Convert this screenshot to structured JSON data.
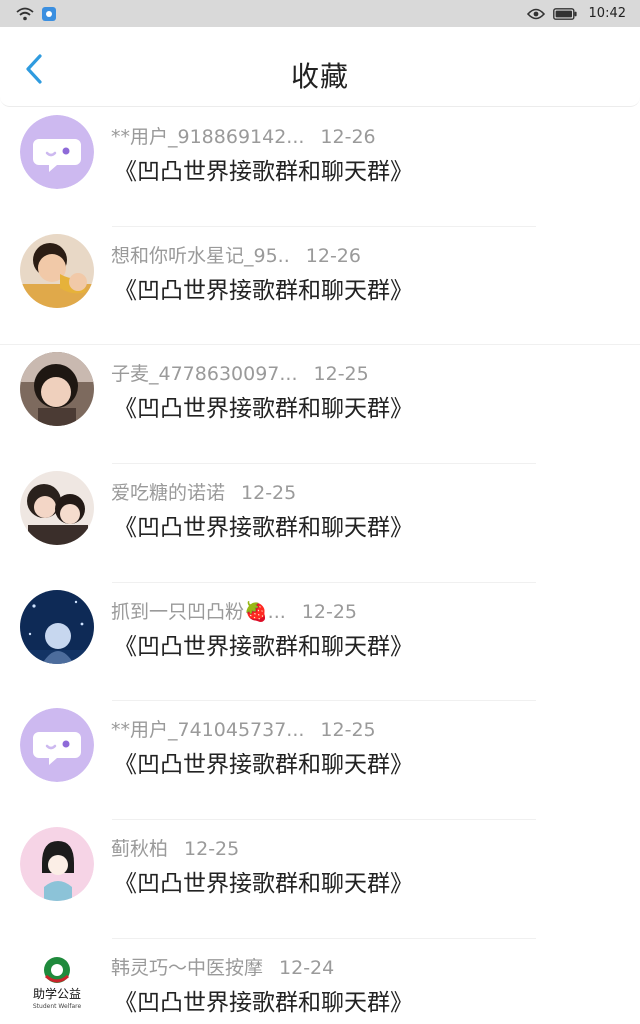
{
  "status": {
    "time": "10:42"
  },
  "header": {
    "title": "收藏"
  },
  "items": [
    {
      "user": "**用户_918869142...",
      "date": "12-26",
      "message": "《凹凸世界接歌群和聊天群》",
      "avatar": "chat-bubble"
    },
    {
      "user": "想和你听水星记_95..",
      "date": "12-26",
      "message": "《凹凸世界接歌群和聊天群》",
      "avatar": "photo-child-eating"
    },
    {
      "user": "子麦_4778630097...",
      "date": "12-25",
      "message": "《凹凸世界接歌群和聊天群》",
      "avatar": "photo-girl"
    },
    {
      "user": "爱吃糖的诺诺",
      "date": "12-25",
      "message": "《凹凸世界接歌群和聊天群》",
      "avatar": "photo-two-girls"
    },
    {
      "user": "抓到一只凹凸粉🍓...",
      "date": "12-25",
      "message": "《凹凸世界接歌群和聊天群》",
      "avatar": "photo-anime-night"
    },
    {
      "user": "**用户_741045737...",
      "date": "12-25",
      "message": "《凹凸世界接歌群和聊天群》",
      "avatar": "chat-bubble"
    },
    {
      "user": "蓟秋柏",
      "date": "12-25",
      "message": "《凹凸世界接歌群和聊天群》",
      "avatar": "illustration-girl"
    },
    {
      "user": "韩灵巧～中医按摩",
      "date": "12-24",
      "message": "《凹凸世界接歌群和聊天群》",
      "avatar": "logo-student-welfare",
      "logo_text": "助学公益",
      "logo_subtext": "Student Welfare"
    }
  ],
  "colors": {
    "accent": "#2f9bdf",
    "bubble_bg": "#cdb9f0"
  }
}
